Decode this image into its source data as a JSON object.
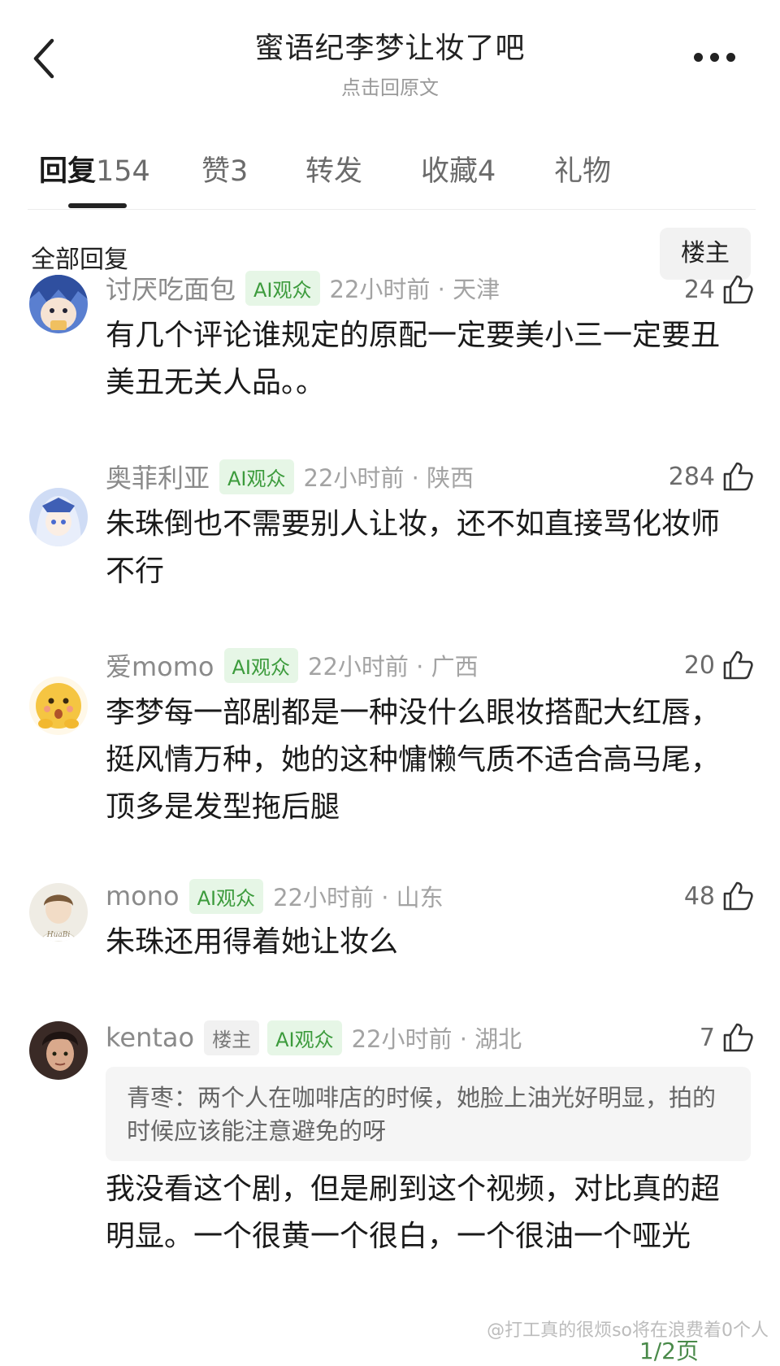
{
  "header": {
    "title": "蜜语纪李梦让妆了吧",
    "subtitle": "点击回原文"
  },
  "tabs": [
    {
      "label": "回复",
      "count": "154"
    },
    {
      "label": "赞",
      "count": "3"
    },
    {
      "label": "转发",
      "count": ""
    },
    {
      "label": "收藏",
      "count": "4"
    },
    {
      "label": "礼物",
      "count": ""
    }
  ],
  "filter": {
    "all_label": "全部回复",
    "owner_label": "楼主"
  },
  "comments": [
    {
      "username": "讨厌吃面包",
      "badge_ai": "AI观众",
      "time": "22小时前 · 天津",
      "likes": "24",
      "text": "有几个评论谁规定的原配一定要美小三一定要丑 美丑无关人品。。"
    },
    {
      "username": "奥菲利亚",
      "badge_ai": "AI观众",
      "time": "22小时前 · 陕西",
      "likes": "284",
      "text": "朱珠倒也不需要别人让妆，还不如直接骂化妆师不行"
    },
    {
      "username": "爱momo",
      "badge_ai": "AI观众",
      "time": "22小时前 · 广西",
      "likes": "20",
      "text": "李梦每一部剧都是一种没什么眼妆搭配大红唇，挺风情万种，她的这种慵懒气质不适合高马尾，顶多是发型拖后腿"
    },
    {
      "username": "mono",
      "badge_ai": "AI观众",
      "time": "22小时前 · 山东",
      "likes": "48",
      "text": "朱珠还用得着她让妆么"
    },
    {
      "username": "kentao",
      "badge_owner": "楼主",
      "badge_ai": "AI观众",
      "time": "22小时前 · 湖北",
      "likes": "7",
      "quote": "青枣：两个人在咖啡店的时候，她脸上油光好明显，拍的时候应该能注意避免的呀",
      "text": "我没看这个剧，但是刷到这个视频，对比真的超明显。一个很黄一个很白，一个很油一个哑光"
    }
  ],
  "watermark": "@打工真的很烦so将在浪费着0个人",
  "pager": "1/2页",
  "colors": {
    "ai_badge_text": "#3c9b3c",
    "ai_badge_bg": "#e6f6e6"
  }
}
